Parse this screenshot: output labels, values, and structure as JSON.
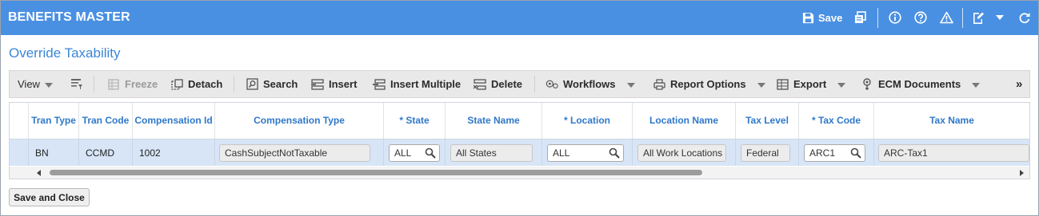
{
  "window": {
    "title": "BENEFITS MASTER",
    "save_label": "Save",
    "icons": [
      "save-icon",
      "print-icon",
      "info-icon",
      "help-icon",
      "warning-icon",
      "edit-icon",
      "chevron-down-icon",
      "refresh-icon"
    ]
  },
  "section": {
    "title": "Override Taxability"
  },
  "toolbar": {
    "view": "View",
    "freeze": "Freeze",
    "detach": "Detach",
    "search": "Search",
    "insert": "Insert",
    "insert_multiple": "Insert Multiple",
    "delete": "Delete",
    "workflows": "Workflows",
    "report_options": "Report Options",
    "export": "Export",
    "ecm_documents": "ECM Documents",
    "more": "»"
  },
  "grid": {
    "columns": {
      "tran_type": "Tran Type",
      "tran_code": "Tran Code",
      "compensation_id": "Compensation Id",
      "compensation_type": "Compensation Type",
      "state": "* State",
      "state_name": "State Name",
      "location": "* Location",
      "location_name": "Location Name",
      "tax_level": "Tax Level",
      "tax_code": "* Tax Code",
      "tax_name": "Tax Name"
    },
    "row": {
      "tran_type": "BN",
      "tran_code": "CCMD",
      "compensation_id": "1002",
      "compensation_type": "CashSubjectNotTaxable",
      "state": "ALL",
      "state_name": "All States",
      "location": "ALL",
      "location_name": "All Work Locations",
      "tax_level": "Federal",
      "tax_code": "ARC1",
      "tax_name": "ARC-Tax1"
    }
  },
  "footer": {
    "save_and_close": "Save and Close"
  },
  "colors": {
    "title_bar": "#4a90e2",
    "accent_text": "#3a86d6",
    "selected_row": "#d7e5f7"
  }
}
